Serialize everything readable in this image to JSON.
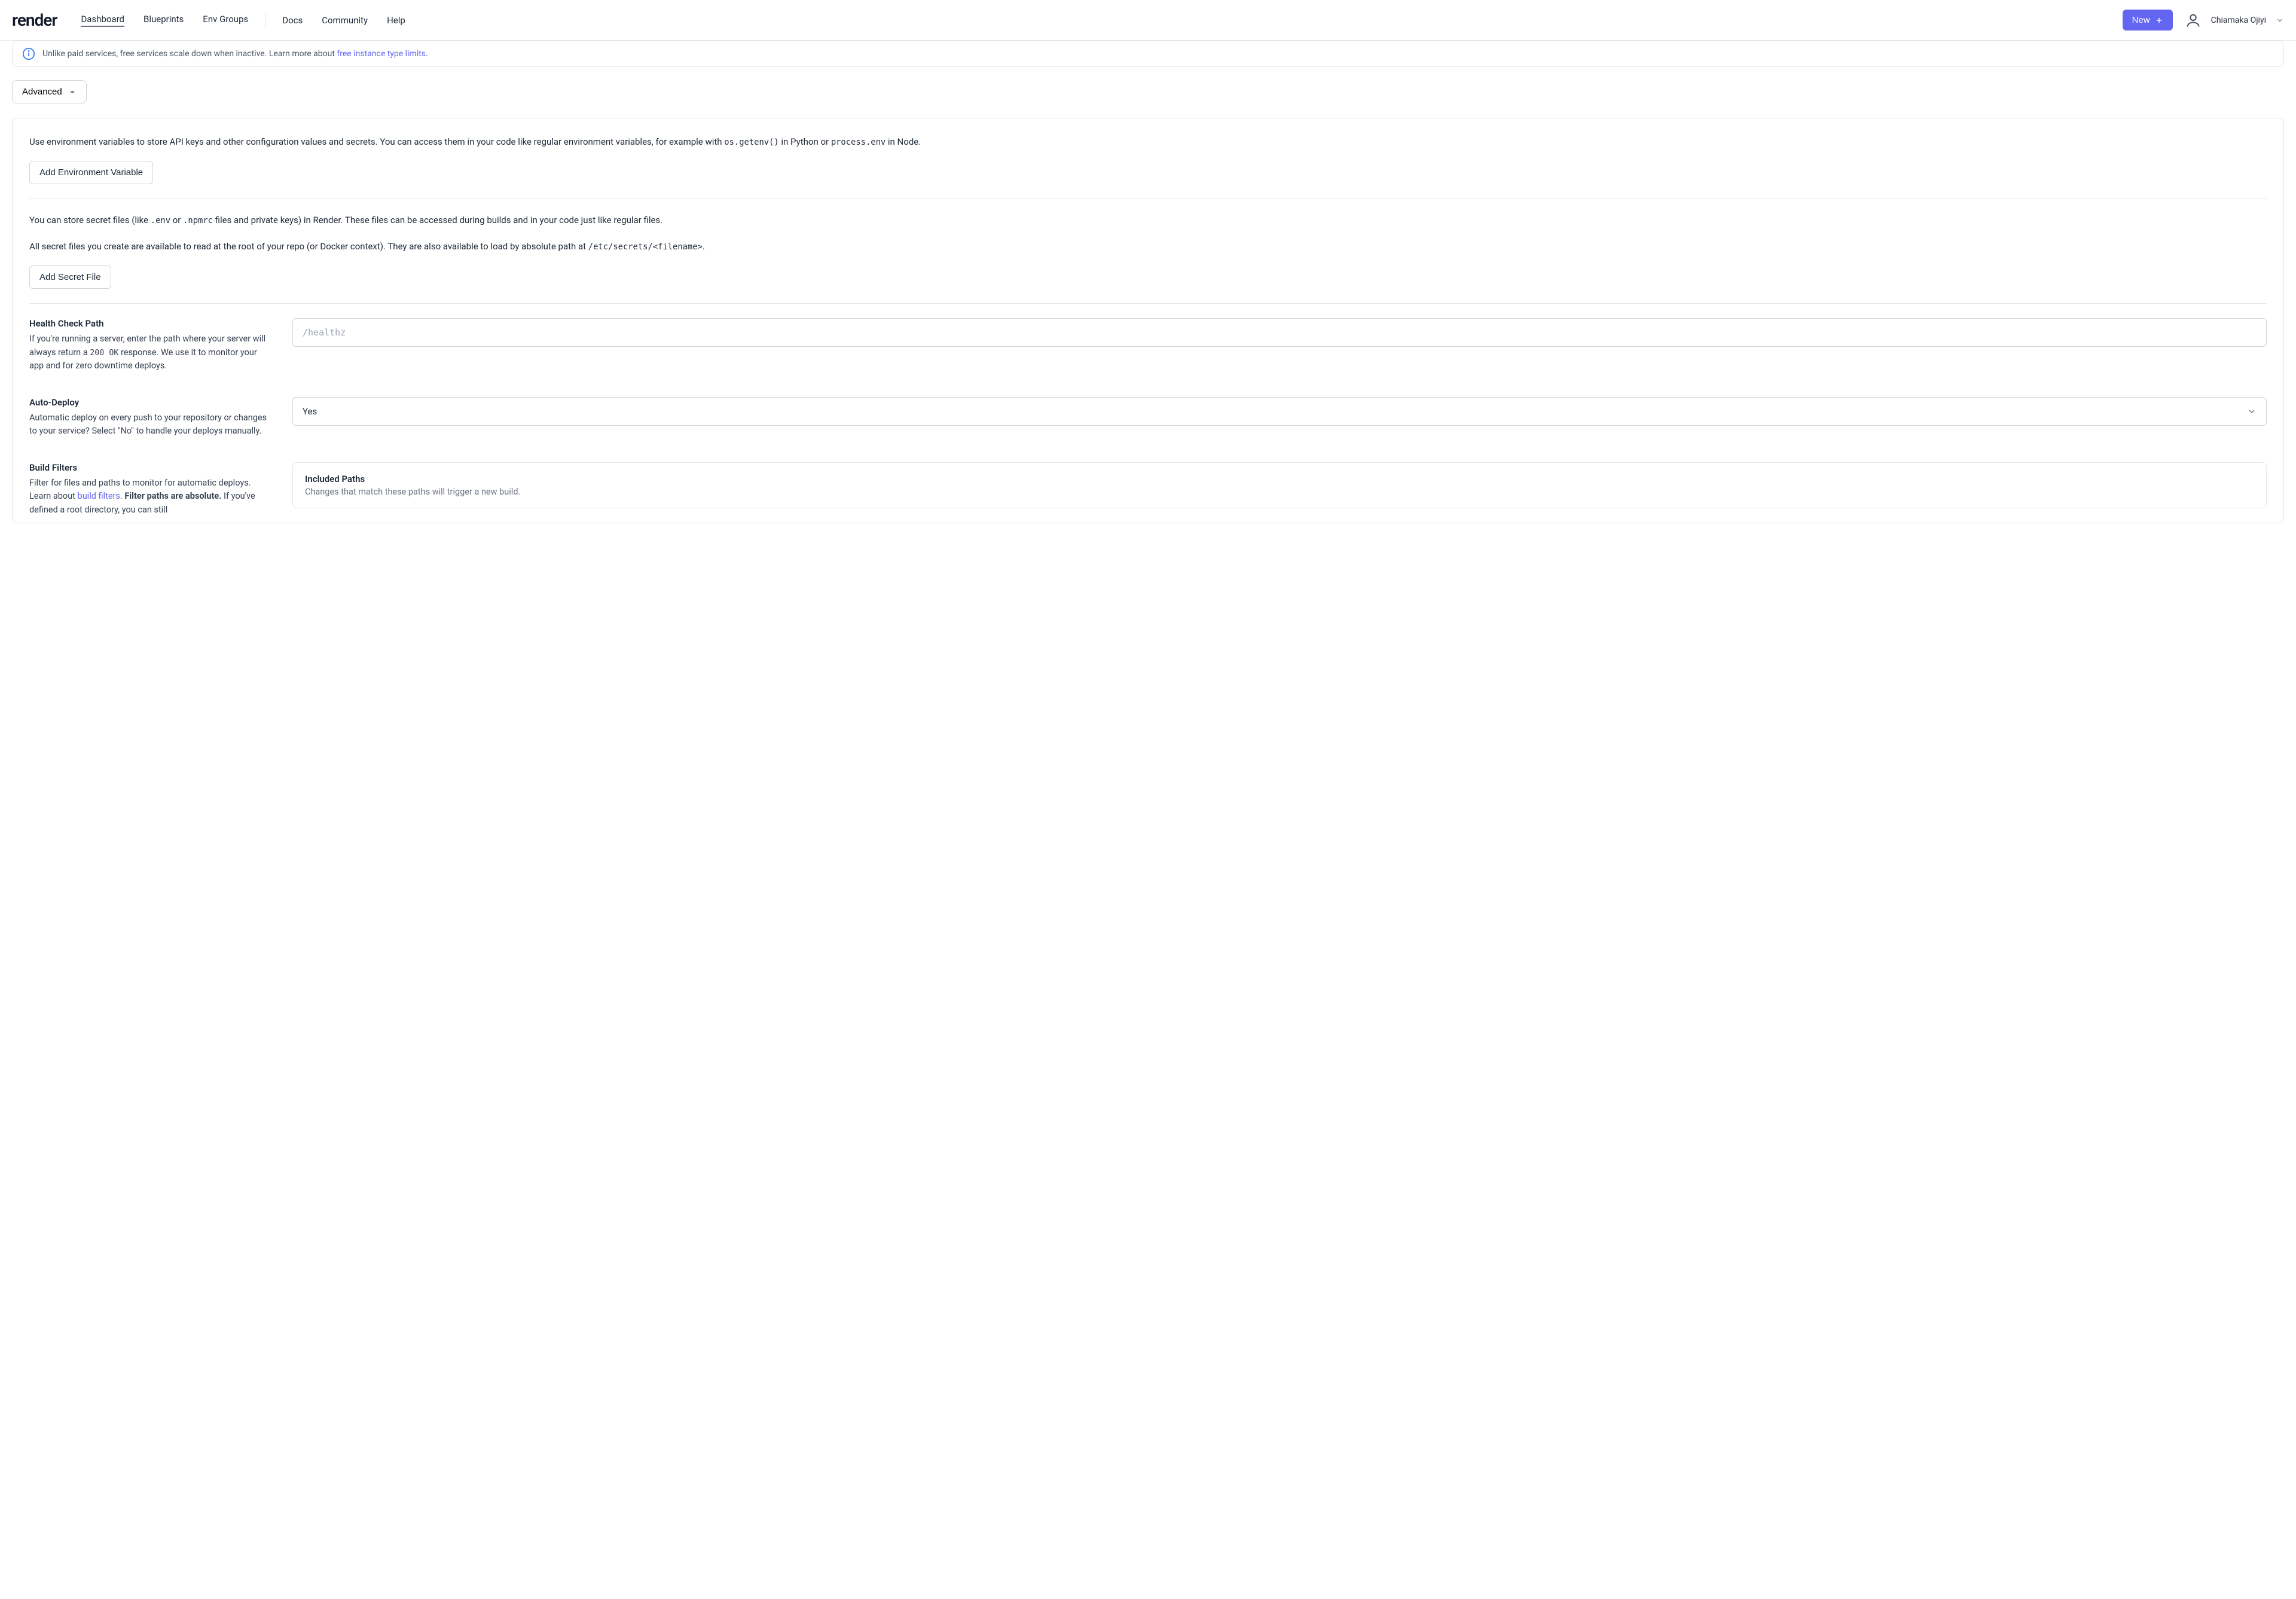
{
  "header": {
    "logo": "render",
    "nav_primary": [
      "Dashboard",
      "Blueprints",
      "Env Groups"
    ],
    "nav_secondary": [
      "Docs",
      "Community",
      "Help"
    ],
    "new_button": "New",
    "user_name": "Chiamaka Ojiyi"
  },
  "banner": {
    "text_before": "Unlike paid services, free services scale down when inactive. Learn more about ",
    "link": "free instance type limits",
    "text_after": "."
  },
  "advanced_button": "Advanced",
  "env": {
    "intro_before": "Use environment variables to store API keys and other configuration values and secrets. You can access them in your code like regular environment variables, for example with ",
    "code1": "os.getenv()",
    "mid1": " in Python or ",
    "code2": "process.env",
    "after1": " in Node.",
    "add_env_var": "Add Environment Variable",
    "secret_intro_before": "You can store secret files (like ",
    "secret_code1": ".env",
    "secret_mid1": " or ",
    "secret_code2": ".npmrc",
    "secret_after1": " files and private keys) in Render. These files can be accessed during builds and in your code just like regular files.",
    "secret_path_text_before": "All secret files you create are available to read at the root of your repo (or Docker context). They are also available to load by absolute path at ",
    "secret_path_code": "/etc/secrets/<filename>",
    "secret_path_after": ".",
    "add_secret_file": "Add Secret File"
  },
  "health": {
    "title": "Health Check Path",
    "desc_before": "If you're running a server, enter the path where your server will always return a ",
    "code": "200 OK",
    "desc_after": " response. We use it to monitor your app and for zero downtime deploys.",
    "placeholder": "/healthz"
  },
  "autodeploy": {
    "title": "Auto-Deploy",
    "desc": "Automatic deploy on every push to your repository or changes to your service? Select \"No\" to handle your deploys manually.",
    "value": "Yes"
  },
  "buildfilters": {
    "title": "Build Filters",
    "desc_before": "Filter for files and paths to monitor for automatic deploys. Learn about ",
    "link": "build filters",
    "desc_mid": ". ",
    "bold": "Filter paths are absolute.",
    "desc_tail": " If you've defined a root directory, you can still",
    "included_title": "Included Paths",
    "included_desc": "Changes that match these paths will trigger a new build."
  }
}
